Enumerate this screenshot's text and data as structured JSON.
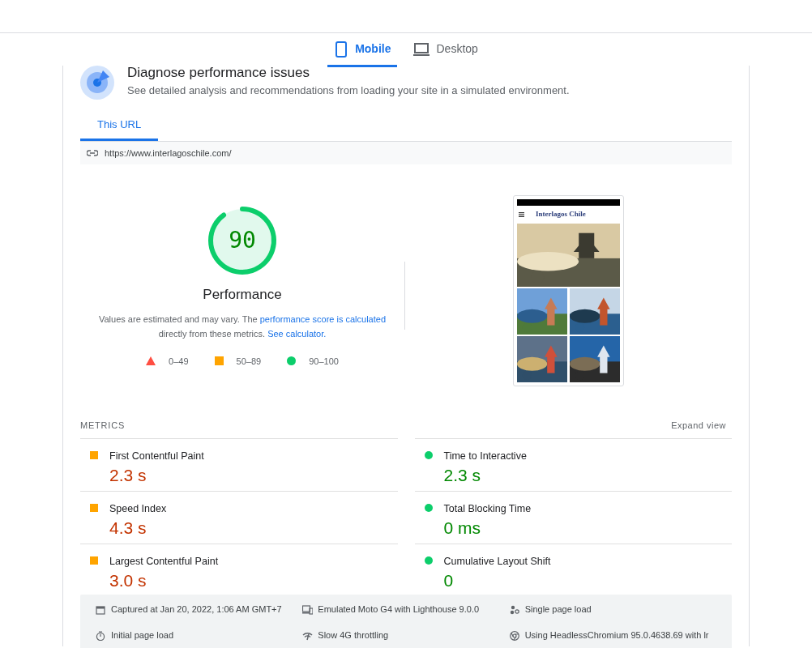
{
  "device_tabs": [
    {
      "label": "Mobile",
      "selected": true
    },
    {
      "label": "Desktop",
      "selected": false
    }
  ],
  "header": {
    "title": "Diagnose performance issues",
    "subtitle": "See detailed analysis and recommendations from loading your site in a simulated environment."
  },
  "url_tabs": [
    {
      "label": "This URL",
      "selected": true
    }
  ],
  "url": "https://www.interlagoschile.com/",
  "gauge": {
    "score": "90",
    "level": 0.9,
    "kind": "pass",
    "label": "Performance"
  },
  "note": {
    "text": "Values are estimated and may vary. The ",
    "link1": "performance score is calculated",
    "text2": "directly from these metrics. ",
    "link2": "See calculator."
  },
  "legend": [
    {
      "kind": "fail",
      "label": "0–49"
    },
    {
      "kind": "average",
      "label": "50–89"
    },
    {
      "kind": "pass",
      "label": "90–100"
    }
  ],
  "thumbnail": {
    "site_name": "Interlagos Chile"
  },
  "metrics_title": "METRICS",
  "expand_label": "Expand view",
  "metrics": [
    {
      "label": "First Contentful Paint",
      "value": "2.3 s",
      "kind": "average"
    },
    {
      "label": "Time to Interactive",
      "value": "2.3 s",
      "kind": "pass"
    },
    {
      "label": "Speed Index",
      "value": "4.3 s",
      "kind": "average"
    },
    {
      "label": "Total Blocking Time",
      "value": "0 ms",
      "kind": "pass"
    },
    {
      "label": "Largest Contentful Paint",
      "value": "3.0 s",
      "kind": "average"
    },
    {
      "label": "Cumulative Layout Shift",
      "value": "0",
      "kind": "pass"
    }
  ],
  "footer": [
    "Captured at Jan 20, 2022, 1:06 AM GMT+7",
    "Emulated Moto G4 with Lighthouse 9.0.0",
    "Single page load",
    "Initial page load",
    "Slow 4G throttling",
    "Using HeadlessChromium 95.0.4638.69 with lr"
  ]
}
